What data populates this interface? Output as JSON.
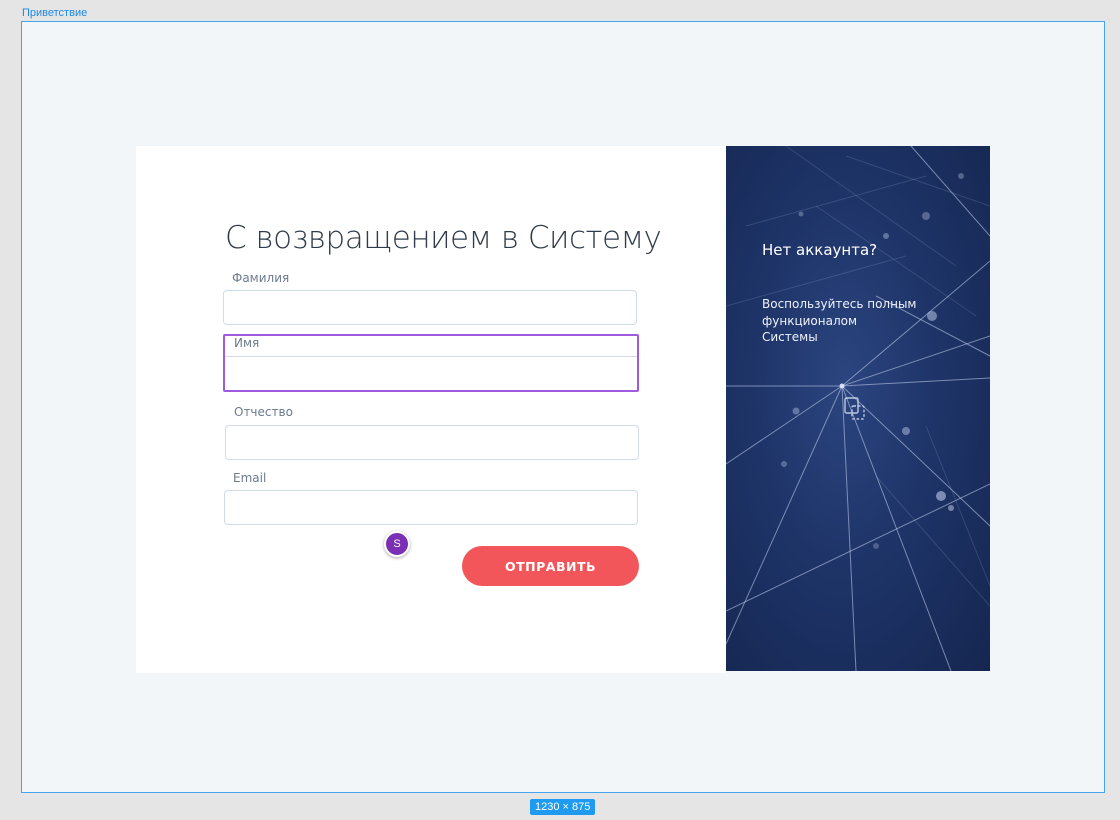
{
  "frame": {
    "label": "Приветствие",
    "dimensions": "1230 × 875"
  },
  "login": {
    "title": "С возвращением в Систему",
    "fields": {
      "surname": {
        "label": "Фамилия",
        "value": ""
      },
      "name": {
        "label": "Имя",
        "value": ""
      },
      "patronymic": {
        "label": "Отчество",
        "value": ""
      },
      "email": {
        "label": "Email",
        "value": ""
      }
    },
    "submit_label": "ОТПРАВИТЬ"
  },
  "collaborator": {
    "initial": "S"
  },
  "promo": {
    "title": "Нет аккаунта?",
    "text": "Воспользуйтесь полным\nфункционалом\nСистемы"
  },
  "icons": {
    "placeholder_image": "image-placeholder-icon"
  },
  "colors": {
    "accent": "#f3565a",
    "selection": "#a05ae0",
    "frame_border": "#43a4f0",
    "panel_dark": "#1e3468",
    "avatar": "#7b2fb5"
  }
}
